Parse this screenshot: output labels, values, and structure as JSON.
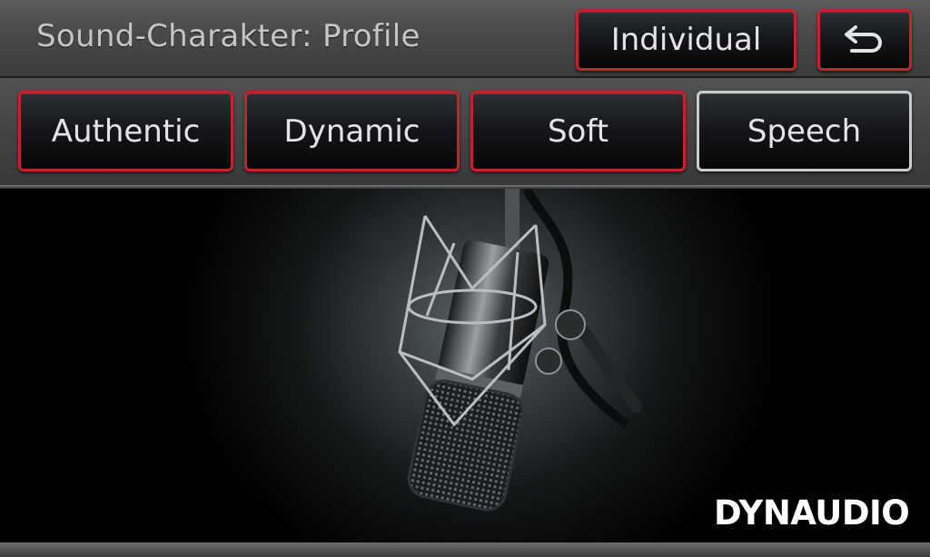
{
  "header": {
    "title": "Sound-Charakter: Profile",
    "individual_label": "Individual",
    "back_icon": "back-arrow-icon"
  },
  "profiles": [
    {
      "label": "Authentic",
      "selected": false
    },
    {
      "label": "Dynamic",
      "selected": false
    },
    {
      "label": "Soft",
      "selected": false
    },
    {
      "label": "Speech",
      "selected": true
    }
  ],
  "stage": {
    "image": "studio-microphone",
    "brand": "DYNAUDIO"
  },
  "colors": {
    "button_border": "#c4232c",
    "selected_border": "#c9cbcc",
    "text": "#e2e4e5"
  }
}
